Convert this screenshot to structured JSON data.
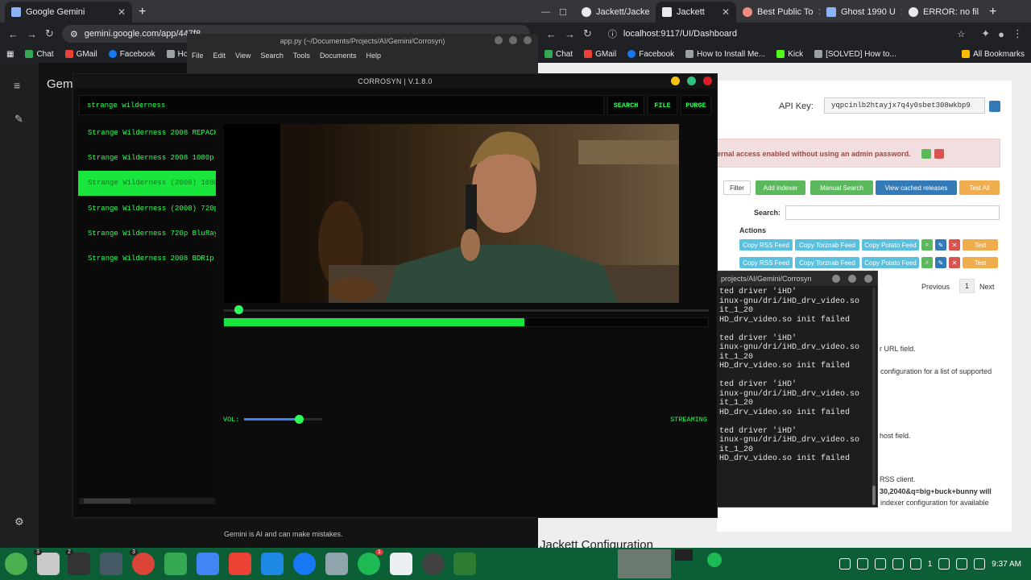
{
  "left_browser": {
    "tabs": [
      {
        "label": "Google Gemini",
        "color": "#8ab4f8"
      }
    ],
    "url": "gemini.google.com/app/447f8",
    "bookmarks": [
      "Chat",
      "GMail",
      "Facebook",
      "How to"
    ],
    "gemini": {
      "title": "Gemi",
      "footer": "Gemini is AI and can make mistakes."
    }
  },
  "right_browser": {
    "tabs": [
      {
        "label": "Jackett/Jacke",
        "color": "#e8eaed"
      },
      {
        "label": "Jackett",
        "color": "#e8eaed"
      },
      {
        "label": "Best Public To",
        "color": "#f28b82"
      },
      {
        "label": "Ghost 1990 U",
        "color": "#8ab4f8"
      },
      {
        "label": "ERROR: no fil",
        "color": "#e8eaed"
      }
    ],
    "url": "localhost:9117/UI/Dashboard",
    "bookmarks": [
      "Chat",
      "GMail",
      "Facebook",
      "How to Install Me...",
      "Kick",
      "[SOLVED] How to..."
    ],
    "all_bookmarks": "All Bookmarks",
    "jackett": {
      "api_key_label": "API Key:",
      "api_key": "yqpcinlb2htayjx7q4y0sbet308wkbp9",
      "warning": "ernal access enabled without using an admin password.",
      "filter": "Filter",
      "buttons": [
        "Add indexer",
        "Manual Search",
        "View cached releases",
        "Test All"
      ],
      "search_label": "Search:",
      "actions_header": "Actions",
      "row_buttons": [
        "Copy RSS Feed",
        "Copy Torznab Feed",
        "Copy Potato Feed",
        "Test"
      ],
      "pagination": {
        "previous": "Previous",
        "page": "1",
        "next": "Next"
      },
      "text_fragments": [
        "r URL field.",
        "configuration for a list of supported",
        "host field.",
        "RSS client.",
        "30,2040&q=big+buck+bunny will",
        "indexer configuration for available"
      ],
      "section_title": "Jackett Configuration"
    }
  },
  "editor": {
    "title": "app.py (~/Documents/Projects/AI/Gemini/Corrosyn)",
    "menu": [
      "File",
      "Edit",
      "View",
      "Search",
      "Tools",
      "Documents",
      "Help"
    ]
  },
  "terminal": {
    "title": "projects/AI/Gemini/Corrosyn",
    "lines": [
      "ted driver 'iHD'",
      "inux-gnu/dri/iHD_drv_video.so",
      "it_1_20",
      "HD_drv_video.so init failed",
      "",
      "ted driver 'iHD'",
      "inux-gnu/dri/iHD_drv_video.so",
      "it_1_20",
      "HD_drv_video.so init failed",
      "",
      "ted driver 'iHD'",
      "inux-gnu/dri/iHD_drv_video.so",
      "it_1_20",
      "HD_drv_video.so init failed",
      "",
      "ted driver 'iHD'",
      "inux-gnu/dri/iHD_drv_video.so",
      "it_1_20",
      "HD_drv_video.so init failed"
    ]
  },
  "app": {
    "title": "CORROSYN | V.1.8.0",
    "search_value": "strange wilderness",
    "buttons": {
      "search": "SEARCH",
      "file": "FILE",
      "purge": "PURGE"
    },
    "results": [
      "Strange Wilderness 2008 REPACK",
      "Strange Wilderness 2008 1080p B",
      "Strange Wilderness (2008) 1080p",
      "Strange Wilderness (2008) 720p",
      "Strange Wilderness 720p BluRay",
      "Strange Wilderness 2008 BDRip"
    ],
    "selected_result": 2,
    "seek_position": 0.03,
    "buffer_progress": 0.62,
    "volume_label": "VOL:",
    "volume": 0.7,
    "status": "STREAMING",
    "colors": {
      "accent": "#2bff5a",
      "selected": "#19e63c",
      "volume": "#3b82f6"
    }
  },
  "taskbar": {
    "badges": [
      "3",
      "2",
      "3",
      "1"
    ],
    "tray_battery": "1",
    "clock": "9:37 AM"
  }
}
